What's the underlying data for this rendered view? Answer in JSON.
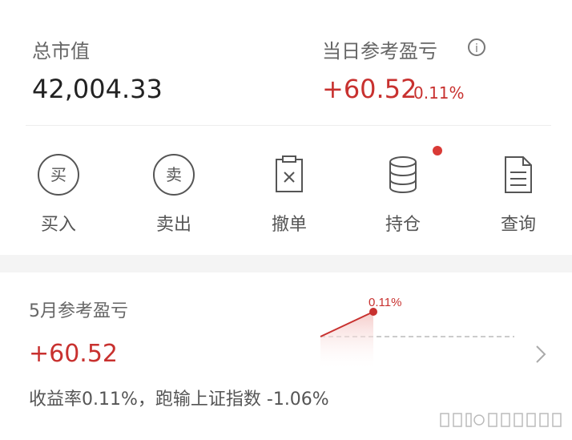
{
  "summary": {
    "total_label": "总市值",
    "total_value": "42,004.33",
    "daily_label": "当日参考盈亏",
    "daily_value": "+60.52",
    "daily_pct": "0.11%"
  },
  "actions": [
    {
      "icon_text": "买",
      "label": "买入"
    },
    {
      "icon_text": "卖",
      "label": "卖出"
    },
    {
      "label": "撤单"
    },
    {
      "label": "持仓"
    },
    {
      "label": "查询"
    }
  ],
  "monthly": {
    "label": "5月参考盈亏",
    "value": "+60.52",
    "desc": "收益率0.11%，跑输上证指数 -1.06%",
    "chart_point_label": "0.11%"
  },
  "colors": {
    "up_red": "#c8312f",
    "text_gray": "#666666"
  },
  "icons": {
    "info": "info-icon",
    "cancel": "cancel-order-icon",
    "holdings": "database-stack-icon",
    "query": "document-icon",
    "more": "chevron-right-icon"
  }
}
